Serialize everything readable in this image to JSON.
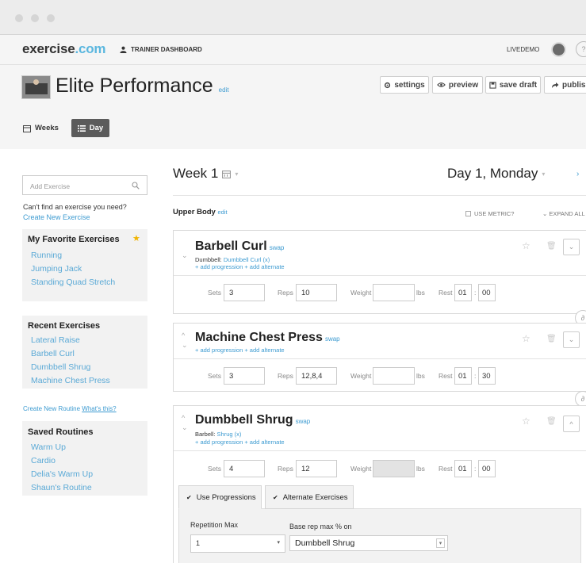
{
  "topbar": {
    "logo_main": "exercise",
    "logo_accent": ".com",
    "dashboard_label": "TRAINER DASHBOARD",
    "user_name": "LIVEDEMO",
    "help_label": "?"
  },
  "header": {
    "title": "Elite Performance",
    "edit_label": "edit",
    "buttons": {
      "settings": "settings",
      "preview": "preview",
      "save_draft": "save draft",
      "publish": "publish"
    },
    "view_toggle": {
      "weeks": "Weeks",
      "day": "Day"
    }
  },
  "sidebar": {
    "search_placeholder": "Add Exercise",
    "cant_find": "Can't find an exercise you need?",
    "create_exercise": "Create New Exercise",
    "favorites": {
      "title": "My Favorite Exercises",
      "items": [
        "Running",
        "Jumping Jack",
        "Standing Quad Stretch"
      ]
    },
    "recent": {
      "title": "Recent Exercises",
      "items": [
        "Lateral Raise",
        "Barbell Curl",
        "Dumbbell Shrug",
        "Machine Chest Press"
      ]
    },
    "create_routine": "Create New Routine",
    "whats_this": "What's this?",
    "saved": {
      "title": "Saved Routines",
      "items": [
        "Warm Up",
        "Cardio",
        "Delia's Warm Up",
        "Shaun's Routine"
      ]
    }
  },
  "main": {
    "week": "Week 1",
    "day": "Day 1, Monday",
    "section": "Upper Body",
    "edit_label": "edit",
    "use_metric": "USE METRIC?",
    "expand_all": "EXPAND ALL"
  },
  "labels": {
    "sets": "Sets",
    "reps": "Reps",
    "weight": "Weight",
    "lbs": "lbs",
    "rest": "Rest",
    "colon": ":",
    "swap": "swap",
    "add_progression": "+ add progression",
    "add_alternate": "+ add alternate"
  },
  "exercises": [
    {
      "name": "Barbell Curl",
      "equipment_label": "Dumbbell:",
      "equipment_value": "Dumbbell Curl (x)",
      "sets": "3",
      "reps": "10",
      "weight": "",
      "rest_min": "01",
      "rest_sec": "00"
    },
    {
      "name": "Machine Chest Press",
      "sets": "3",
      "reps": "12,8,4",
      "weight": "",
      "rest_min": "01",
      "rest_sec": "30"
    },
    {
      "name": "Dumbbell Shrug",
      "equipment_label": "Barbell:",
      "equipment_value": "Shrug (x)",
      "sets": "4",
      "reps": "12",
      "weight": "",
      "rest_min": "01",
      "rest_sec": "00"
    }
  ],
  "progressions": {
    "tab_use": "Use Progressions",
    "tab_alternate": "Alternate Exercises",
    "rep_max_label": "Repetition Max",
    "rep_max_value": "1",
    "base_label": "Base rep max % on",
    "base_value": "Dumbbell Shrug"
  }
}
